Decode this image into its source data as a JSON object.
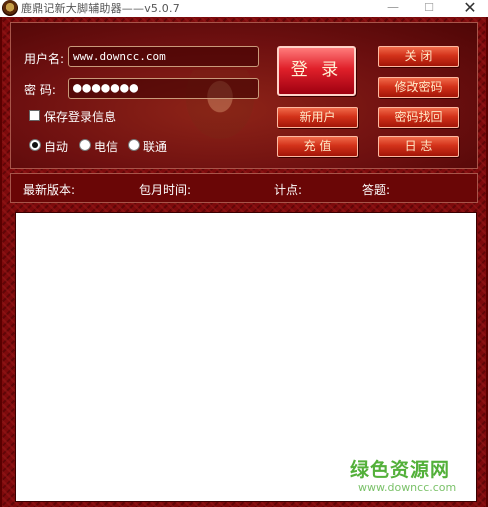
{
  "window": {
    "title": "鹿鼎记新大脚辅助器——v5.0.7",
    "minimize_glyph": "—",
    "maximize_glyph": "☐",
    "close_glyph": "✕"
  },
  "login": {
    "username_label": "用户名:",
    "username_value": "www.downcc.com",
    "password_label": "密  码:",
    "password_value": "●●●●●●●",
    "save_login_label": "保存登录信息",
    "save_login_checked": false,
    "line_options": [
      {
        "label": "自动",
        "checked": true
      },
      {
        "label": "电信",
        "checked": false
      },
      {
        "label": "联通",
        "checked": false
      }
    ]
  },
  "buttons": {
    "login": "登 录",
    "close": "关  闭",
    "change_password": "修改密码",
    "new_user": "新用户",
    "recover_password": "密码找回",
    "recharge": "充  值",
    "log": "日  志"
  },
  "status": {
    "latest_version_label": "最新版本:",
    "monthly_time_label": "包月时间:",
    "points_label": "计点:",
    "answers_label": "答题:"
  },
  "watermark": {
    "text": "绿色资源网",
    "url": "www.downcc.com"
  }
}
